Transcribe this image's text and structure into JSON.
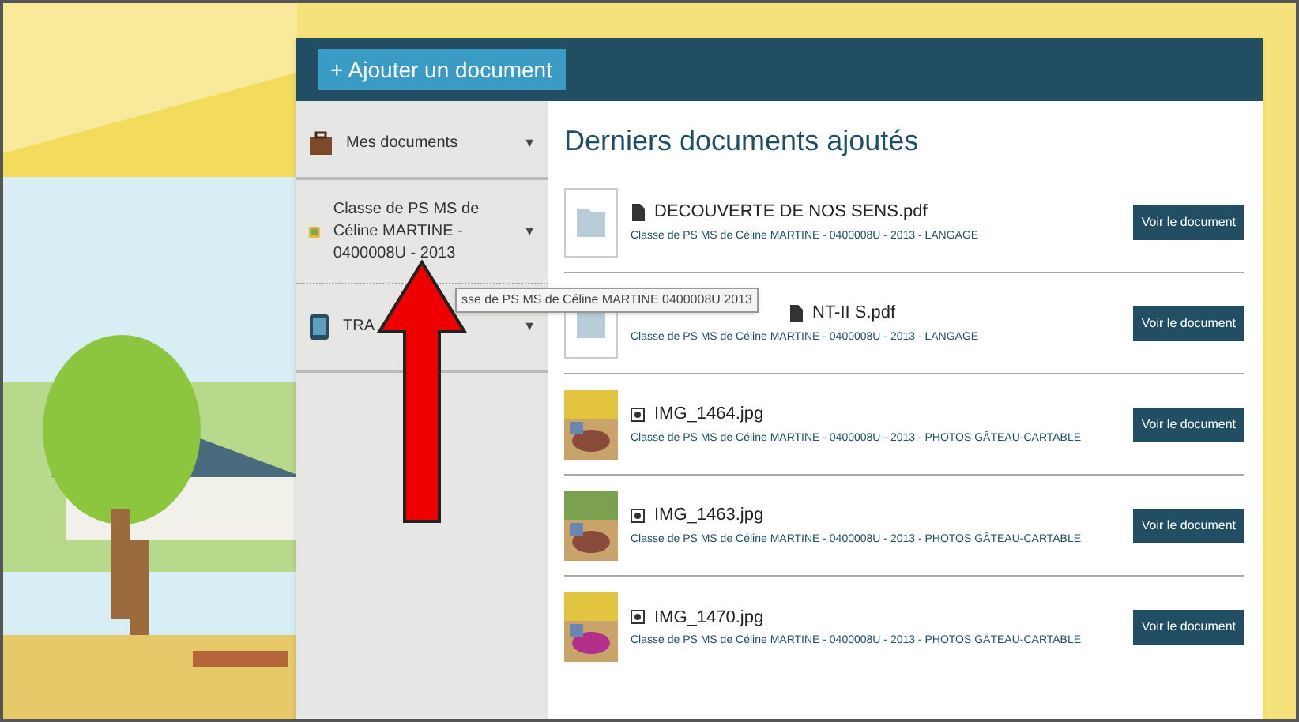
{
  "toolbar": {
    "add_button": "+ Ajouter un document"
  },
  "sidebar": {
    "items": [
      {
        "kind": "briefcase",
        "label": "Mes documents",
        "caret": "▼"
      },
      {
        "kind": "class",
        "label": "Classe de PS MS de Céline MARTINE - 0400008U - 2013",
        "caret": "▼"
      },
      {
        "kind": "tablet",
        "label": "TRA",
        "caret": "▼"
      }
    ]
  },
  "tooltip": "sse de PS MS de Céline MARTINE  0400008U  2013",
  "main": {
    "title": "Derniers documents ajoutés",
    "documents": [
      {
        "kind": "file",
        "name": "DECOUVERTE DE NOS SENS.pdf",
        "path": "Classe de PS MS de Céline MARTINE - 0400008U - 2013 - LANGAGE",
        "button": "Voir le document"
      },
      {
        "kind": "file",
        "name": "NT-II S.pdf",
        "path": "Classe de PS MS de Céline MARTINE - 0400008U - 2013 - LANGAGE",
        "button": "Voir le document"
      },
      {
        "name": "IMG_1464.jpg",
        "path": "Classe de PS MS de Céline MARTINE - 0400008U - 2013 - PHOTOS GÂTEAU-CARTABLE",
        "button": "Voir le document"
      },
      {
        "name": "IMG_1463.jpg",
        "path": "Classe de PS MS de Céline MARTINE - 0400008U - 2013 - PHOTOS GÂTEAU-CARTABLE",
        "button": "Voir le document"
      },
      {
        "name": "IMG_1470.jpg",
        "path": "Classe de PS MS de Céline MARTINE - 0400008U - 2013 - PHOTOS GÂTEAU-CARTABLE",
        "button": "Voir le document"
      }
    ]
  }
}
